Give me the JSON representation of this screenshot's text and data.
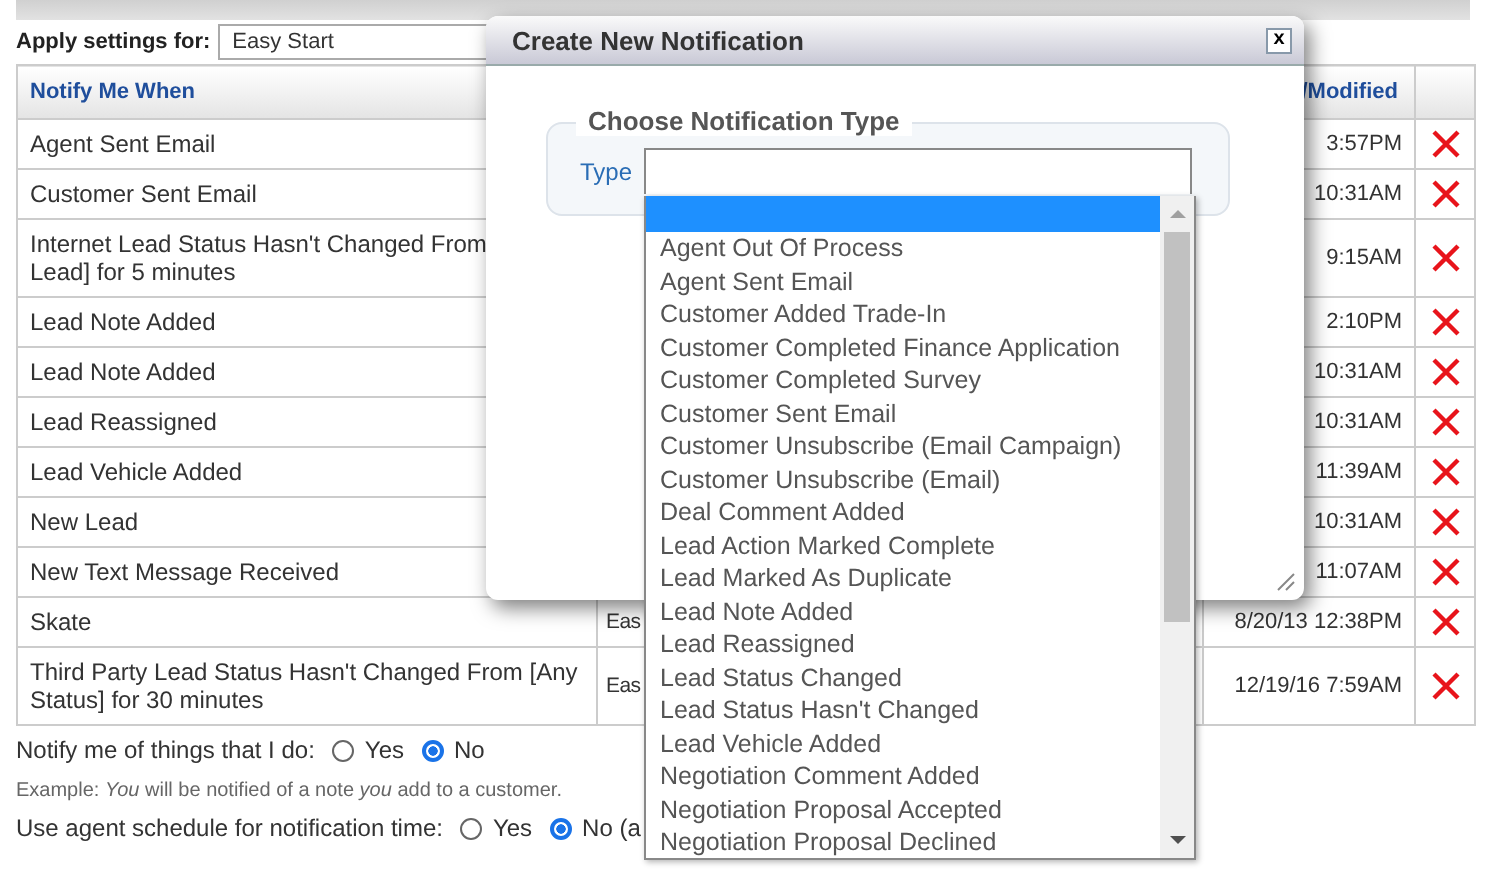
{
  "settings": {
    "label": "Apply settings for:",
    "value": "Easy Start"
  },
  "table": {
    "column_1": "Notify Me When",
    "column_3": "/Modified",
    "rows": [
      {
        "event": "Agent Sent Email",
        "modified": "3:57PM"
      },
      {
        "event": "Customer Sent Email",
        "modified": "10:31AM"
      },
      {
        "event": "Internet Lead Status Hasn't Changed From\nLead] for 5 minutes",
        "modified": "9:15AM"
      },
      {
        "event": "Lead Note Added",
        "modified": "2:10PM"
      },
      {
        "event": "Lead Note Added",
        "modified": "10:31AM"
      },
      {
        "event": "Lead Reassigned",
        "modified": "10:31AM"
      },
      {
        "event": "Lead Vehicle Added",
        "modified": "11:39AM"
      },
      {
        "event": "New Lead",
        "modified": "10:31AM"
      },
      {
        "event": "New Text Message Received",
        "modified": "11:07AM"
      },
      {
        "event": "Skate",
        "column_2": "Eas",
        "modified": "8/20/13 12:38PM"
      },
      {
        "event": "Third Party Lead Status Hasn't Changed From [Any Status] for 30 minutes",
        "column_2": "Eas",
        "modified": "12/19/16 7:59AM"
      }
    ]
  },
  "notify_self": {
    "label": "Notify me of things that I do:",
    "options": [
      {
        "label": "Yes",
        "selected": false
      },
      {
        "label": "No",
        "selected": true
      }
    ]
  },
  "example": "Example: *You* will be notified of a note *you* add to a customer.",
  "agent_schedule": {
    "label": "Use agent schedule for notification time:",
    "options": [
      {
        "label": "Yes",
        "selected": false
      },
      {
        "label": "No (a",
        "selected": true
      }
    ]
  },
  "dialog": {
    "title": "Create New Notification",
    "close": "x",
    "legend": "Choose Notification Type",
    "type_label": "Type",
    "dropdown": {
      "options": [
        {
          "selected": true
        },
        {
          "label": "Agent Out Of Process",
          "selected": false
        },
        {
          "label": "Agent Sent Email",
          "selected": false
        },
        {
          "label": "Customer Added Trade-In",
          "selected": false
        },
        {
          "label": "Customer Completed Finance Application",
          "selected": false
        },
        {
          "label": "Customer Completed Survey",
          "selected": false
        },
        {
          "label": "Customer Sent Email",
          "selected": false
        },
        {
          "label": "Customer Unsubscribe (Email Campaign)",
          "selected": false
        },
        {
          "label": "Customer Unsubscribe (Email)",
          "selected": false
        },
        {
          "label": "Deal Comment Added",
          "selected": false
        },
        {
          "label": "Lead Action Marked Complete",
          "selected": false
        },
        {
          "label": "Lead Marked As Duplicate",
          "selected": false
        },
        {
          "label": "Lead Note Added",
          "selected": false
        },
        {
          "label": "Lead Reassigned",
          "selected": false
        },
        {
          "label": "Lead Status Changed",
          "selected": false
        },
        {
          "label": "Lead Status Hasn't Changed",
          "selected": false
        },
        {
          "label": "Lead Vehicle Added",
          "selected": false
        },
        {
          "label": "Negotiation Comment Added",
          "selected": false
        },
        {
          "label": "Negotiation Proposal Accepted",
          "selected": false
        },
        {
          "label": "Negotiation Proposal Declined",
          "selected": false
        }
      ]
    }
  }
}
